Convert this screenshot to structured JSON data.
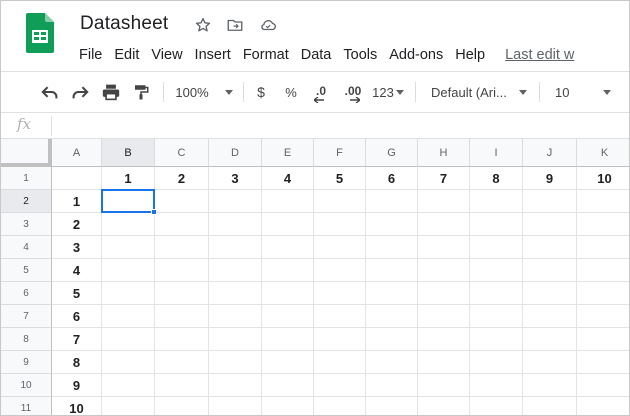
{
  "document": {
    "title": "Datasheet",
    "icons": [
      "star-icon",
      "move-to-folder-icon",
      "cloud-saved-icon"
    ]
  },
  "menu": {
    "items": [
      "File",
      "Edit",
      "View",
      "Insert",
      "Format",
      "Data",
      "Tools",
      "Add-ons",
      "Help"
    ],
    "last_edit": "Last edit w"
  },
  "toolbar": {
    "zoom": "100%",
    "currency": "$",
    "percent": "%",
    "decrease_decimals": ".0",
    "increase_decimals": ".00",
    "more_formats": "123",
    "font_family": "Default (Ari...",
    "font_size": "10",
    "icons": [
      "undo-icon",
      "redo-icon",
      "print-icon",
      "paint-format-icon"
    ]
  },
  "formula_bar": {
    "label": "fx",
    "value": ""
  },
  "sheet": {
    "columns": [
      "A",
      "B",
      "C",
      "D",
      "E",
      "F",
      "G",
      "H",
      "I",
      "J",
      "K"
    ],
    "rows": [
      "1",
      "2",
      "3",
      "4",
      "5",
      "6",
      "7",
      "8",
      "9",
      "10",
      "11"
    ],
    "selected_cell": "B2",
    "row1_values": [
      "",
      "1",
      "2",
      "3",
      "4",
      "5",
      "6",
      "7",
      "8",
      "9",
      "10"
    ],
    "colA_values": [
      "",
      "1",
      "2",
      "3",
      "4",
      "5",
      "6",
      "7",
      "8",
      "9",
      "10"
    ]
  },
  "colors": {
    "accent": "#1a73e8",
    "sheets_green": "#0f9d58"
  }
}
